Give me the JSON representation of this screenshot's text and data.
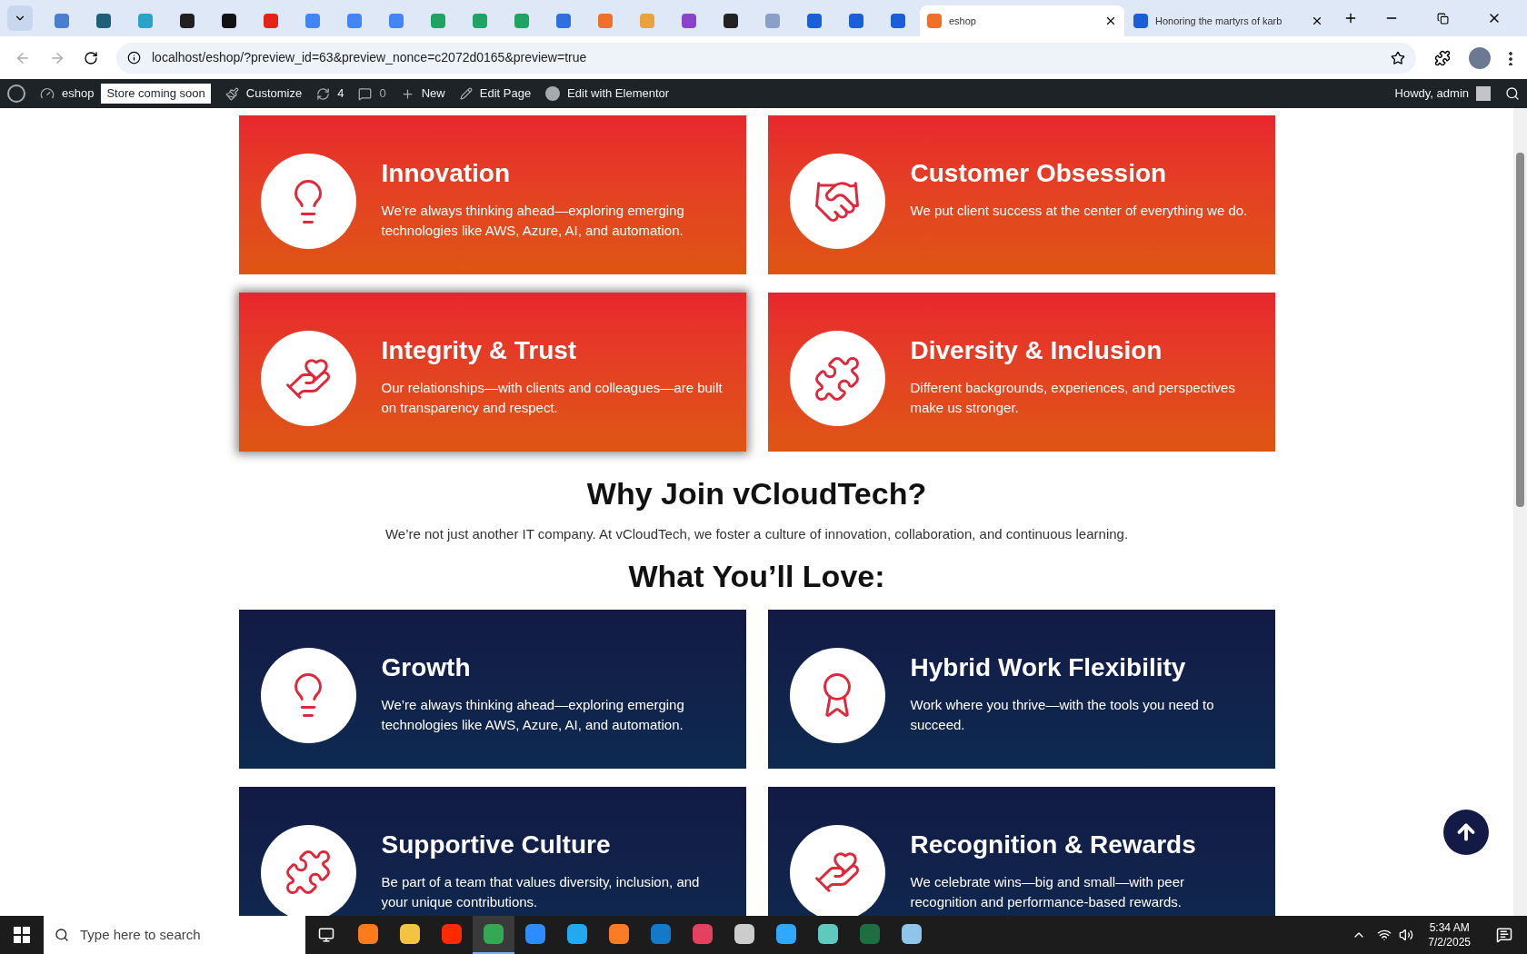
{
  "browser": {
    "tabs": [
      {
        "selected": false,
        "color": "#4a7fd0"
      },
      {
        "selected": false,
        "color": "#1f5f7a"
      },
      {
        "selected": false,
        "color": "#2aa3c9"
      },
      {
        "selected": false,
        "color": "#202020"
      },
      {
        "selected": false,
        "color": "#111111"
      },
      {
        "selected": false,
        "color": "#e62117"
      },
      {
        "selected": false,
        "color": "#4285f4"
      },
      {
        "selected": false,
        "color": "#4285f4"
      },
      {
        "selected": false,
        "color": "#4285f4"
      },
      {
        "selected": false,
        "color": "#1fa463"
      },
      {
        "selected": false,
        "color": "#1fa463"
      },
      {
        "selected": false,
        "color": "#1fa463"
      },
      {
        "selected": false,
        "color": "#2f6fde"
      },
      {
        "selected": false,
        "color": "#f0702a"
      },
      {
        "selected": false,
        "color": "#e8a33a"
      },
      {
        "selected": false,
        "color": "#8b44c9"
      },
      {
        "selected": false,
        "color": "#222222"
      },
      {
        "selected": false,
        "color": "#8aa0c8"
      },
      {
        "selected": false,
        "color": "#1a5fd8"
      },
      {
        "selected": false,
        "color": "#1a5fd8"
      },
      {
        "selected": false,
        "color": "#1a5fd8"
      },
      {
        "title": "eshop",
        "selected": true,
        "color": "#f0702a"
      },
      {
        "title": "Honoring the martyrs of karb",
        "selected": false,
        "color": "#1a5fd8"
      }
    ],
    "url": "localhost/eshop/?preview_id=63&preview_nonce=c2072d0165&preview=true"
  },
  "admin_bar": {
    "site": "eshop",
    "badge": "Store coming soon",
    "customize": "Customize",
    "updates": "4",
    "comments": "0",
    "new": "New",
    "edit_page": "Edit Page",
    "elementor": "Edit with Elementor",
    "greeting": "Howdy, admin"
  },
  "values": [
    {
      "title": "Innovation",
      "text": "We’re always thinking ahead—exploring emerging technologies like AWS, Azure, AI, and automation.",
      "hovered": false
    },
    {
      "title": "Customer Obsession",
      "text": "We put client success at the center of everything we do.",
      "hovered": false
    },
    {
      "title": "Integrity & Trust",
      "text": "Our relationships—with clients and colleagues—are built on transparency and respect.",
      "hovered": true
    },
    {
      "title": "Diversity & Inclusion",
      "text": "Different backgrounds, experiences, and perspectives make us stronger.",
      "hovered": false
    }
  ],
  "why_join": {
    "heading": "Why Join vCloudTech?",
    "text": "We’re not just another IT company. At vCloudTech, we foster a culture of innovation, collaboration, and continuous learning."
  },
  "love_heading": "What You’ll Love:",
  "love": [
    {
      "title": "Growth",
      "text": "We’re always thinking ahead—exploring emerging technologies like AWS, Azure, AI, and automation.",
      "hovered": false
    },
    {
      "title": "Hybrid Work Flexibility",
      "text": "Work where you thrive—with the tools you need to succeed.",
      "hovered": false
    },
    {
      "title": "Supportive Culture",
      "text": "Be part of a team that values diversity, inclusion, and your unique contributions.",
      "hovered": false
    },
    {
      "title": "Recognition & Rewards",
      "text": "We celebrate wins—big and small—with peer recognition and performance-based rewards.",
      "hovered": false
    }
  ],
  "taskbar": {
    "search": {
      "placeholder": "Type here to search"
    },
    "apps": [
      {
        "selected": false,
        "color": "#ff7a1a"
      },
      {
        "selected": false,
        "color": "#f5c342"
      },
      {
        "selected": false,
        "color": "#ff2a00"
      },
      {
        "selected": true,
        "color": "#34a853"
      },
      {
        "selected": false,
        "color": "#2d8cff"
      },
      {
        "selected": false,
        "color": "#23a9f2"
      },
      {
        "selected": false,
        "color": "#fb7a24"
      },
      {
        "selected": false,
        "color": "#1479c9"
      },
      {
        "selected": false,
        "color": "#e4405f"
      },
      {
        "selected": false,
        "color": "#cccccc"
      },
      {
        "selected": false,
        "color": "#31a8ff"
      },
      {
        "selected": false,
        "color": "#5fc9c0"
      },
      {
        "selected": false,
        "color": "#1d6f42"
      },
      {
        "selected": false,
        "color": "#8ec5e8"
      }
    ],
    "time": "5:34 AM",
    "date": "7/2/2025"
  }
}
